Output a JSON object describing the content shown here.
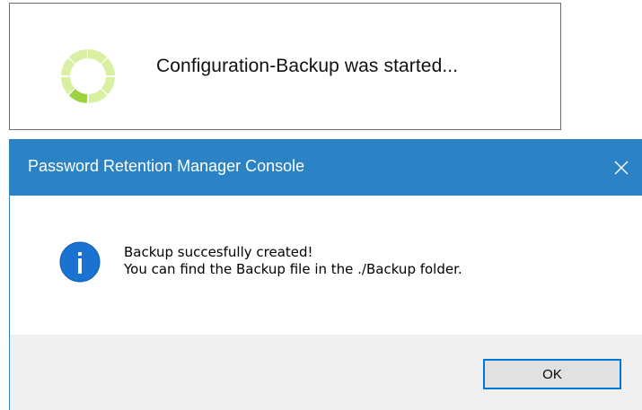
{
  "toast": {
    "icon": "loading-spinner-icon",
    "message": "Configuration-Backup was started..."
  },
  "dialog": {
    "title": "Password Retention Manager Console",
    "close_icon": "close-icon",
    "info_icon": "info-icon",
    "message_line1": "Backup succesfully created!",
    "message_line2": "You can find the Backup file in the ./Backup folder.",
    "ok_label": "OK"
  },
  "colors": {
    "titlebar": "#2b83c6",
    "spinner_light": "#d7ef9d",
    "spinner_dark": "#9bd03f",
    "info_blue": "#1572d8",
    "button_border": "#0078d7",
    "footer_bg": "#f0f0f0"
  }
}
